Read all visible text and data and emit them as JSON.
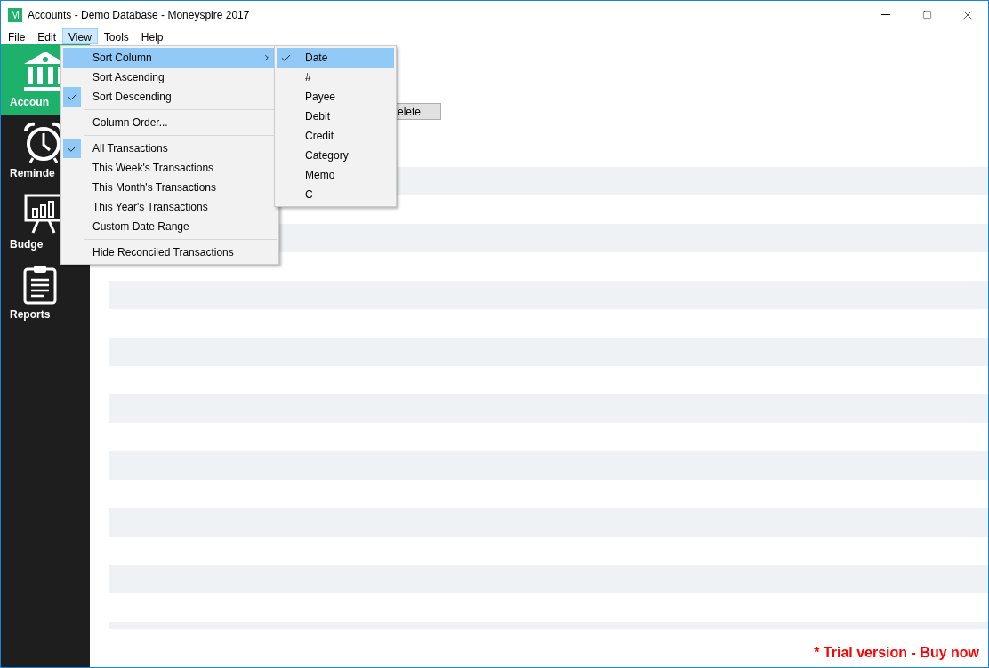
{
  "window": {
    "title": "Accounts - Demo Database - Moneyspire 2017",
    "app_icon": "M"
  },
  "menubar": [
    {
      "label": "File",
      "selected": false
    },
    {
      "label": "Edit",
      "selected": false
    },
    {
      "label": "View",
      "selected": true
    },
    {
      "label": "Tools",
      "selected": false
    },
    {
      "label": "Help",
      "selected": false
    }
  ],
  "sidebar": [
    {
      "label": "Accoun",
      "selected": true
    },
    {
      "label": "Reminde",
      "selected": false
    },
    {
      "label": "Budge",
      "selected": false
    },
    {
      "label": "Reports",
      "selected": false
    }
  ],
  "content": {
    "button": "elete",
    "footer_link": "* Trial version - Buy now"
  },
  "view_menu": [
    {
      "kind": "item",
      "label": "Sort Column",
      "submenu": true,
      "checked": false,
      "selected": true
    },
    {
      "kind": "item",
      "label": "Sort Ascending",
      "submenu": false,
      "checked": false,
      "selected": false
    },
    {
      "kind": "item",
      "label": "Sort Descending",
      "submenu": false,
      "checked": true,
      "selected": false
    },
    {
      "kind": "separator"
    },
    {
      "kind": "item",
      "label": "Column Order...",
      "submenu": false,
      "checked": false,
      "selected": false
    },
    {
      "kind": "separator"
    },
    {
      "kind": "item",
      "label": "All Transactions",
      "submenu": false,
      "checked": true,
      "selected": false
    },
    {
      "kind": "item",
      "label": "This Week's Transactions",
      "submenu": false,
      "checked": false,
      "selected": false
    },
    {
      "kind": "item",
      "label": "This Month's Transactions",
      "submenu": false,
      "checked": false,
      "selected": false
    },
    {
      "kind": "item",
      "label": "This Year's Transactions",
      "submenu": false,
      "checked": false,
      "selected": false
    },
    {
      "kind": "item",
      "label": "Custom Date Range",
      "submenu": false,
      "checked": false,
      "selected": false
    },
    {
      "kind": "separator"
    },
    {
      "kind": "item",
      "label": "Hide Reconciled Transactions",
      "submenu": false,
      "checked": false,
      "selected": false
    }
  ],
  "sort_submenu": [
    {
      "label": "Date",
      "checked": true,
      "selected": true
    },
    {
      "label": "#",
      "checked": false,
      "selected": false
    },
    {
      "label": "Payee",
      "checked": false,
      "selected": false
    },
    {
      "label": "Debit",
      "checked": false,
      "selected": false
    },
    {
      "label": "Credit",
      "checked": false,
      "selected": false
    },
    {
      "label": "Category",
      "checked": false,
      "selected": false
    },
    {
      "label": "Memo",
      "checked": false,
      "selected": false
    },
    {
      "label": "C",
      "checked": false,
      "selected": false
    }
  ]
}
